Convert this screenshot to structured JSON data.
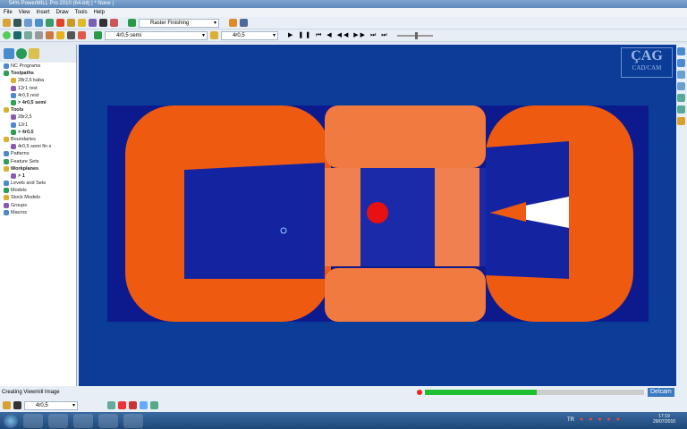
{
  "window": {
    "title": "54% PowerMILL Pro 2010 (64-bit)   |   * None |"
  },
  "menu": [
    "File",
    "View",
    "Insert",
    "Draw",
    "Tools",
    "Help"
  ],
  "toolbar1": {
    "strategy": "Raster Finishing"
  },
  "toolbar2": {
    "toolpath": "4r0,5 semi",
    "tool": "4r0,5"
  },
  "tree": [
    {
      "label": "NC Programs",
      "bold": false,
      "indent": 1
    },
    {
      "label": "Toolpaths",
      "bold": true,
      "indent": 1
    },
    {
      "label": "28r2,5 kaba",
      "bold": false,
      "indent": 3
    },
    {
      "label": "12r1 rest",
      "bold": false,
      "indent": 3
    },
    {
      "label": "4r0,5 rest",
      "bold": false,
      "indent": 3
    },
    {
      "label": "> 4r0,5 semi",
      "bold": true,
      "indent": 3
    },
    {
      "label": "Tools",
      "bold": true,
      "indent": 1
    },
    {
      "label": "28r2,5",
      "bold": false,
      "indent": 3
    },
    {
      "label": "12r1",
      "bold": false,
      "indent": 3
    },
    {
      "label": "> 4r0,5",
      "bold": true,
      "indent": 3
    },
    {
      "label": "Boundaries",
      "bold": false,
      "indent": 1
    },
    {
      "label": "4r0,5 semi fin s",
      "bold": false,
      "indent": 3
    },
    {
      "label": "Patterns",
      "bold": false,
      "indent": 1
    },
    {
      "label": "Feature Sets",
      "bold": false,
      "indent": 1
    },
    {
      "label": "Workplanes",
      "bold": true,
      "indent": 1
    },
    {
      "label": "> 1",
      "bold": true,
      "indent": 3
    },
    {
      "label": "Levels and Sets",
      "bold": false,
      "indent": 1
    },
    {
      "label": "Models",
      "bold": false,
      "indent": 1
    },
    {
      "label": "Stock Models",
      "bold": false,
      "indent": 1
    },
    {
      "label": "Groups",
      "bold": false,
      "indent": 1
    },
    {
      "label": "Macros",
      "bold": false,
      "indent": 1
    }
  ],
  "viewport": {
    "logo_line1": "ÇAG",
    "logo_line2": "CAD/CAM"
  },
  "status": {
    "text": "Creating Viewmill Image",
    "progress": 0.51,
    "brand": "Delcam"
  },
  "bottom": {
    "tool": "4r0,5"
  },
  "taskbar": {
    "lang": "TR",
    "time": "17:19",
    "date": "29/07/2010"
  }
}
